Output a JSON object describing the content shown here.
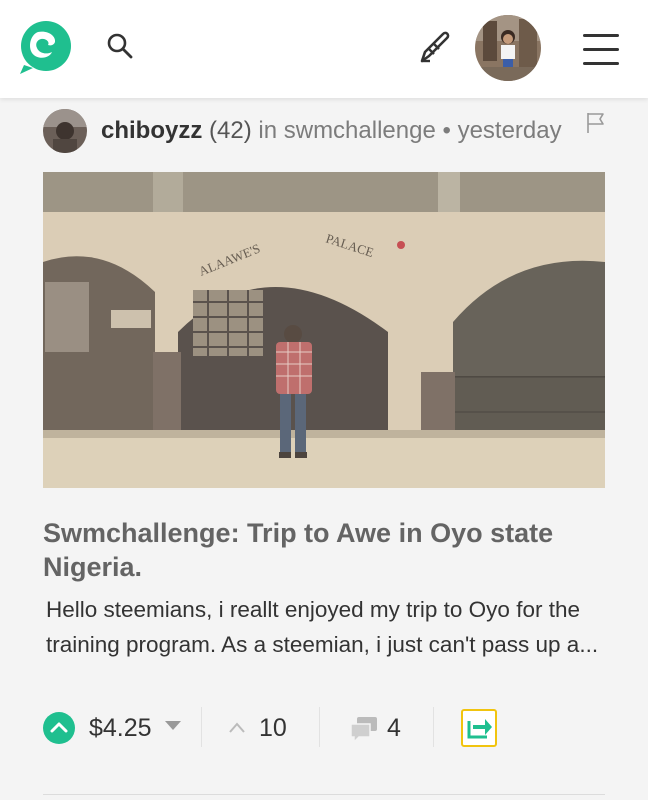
{
  "header": {
    "logo_icon": "steemit-logo-icon",
    "search_icon": "search-icon",
    "compose_icon": "pen-icon",
    "avatar": "user-avatar",
    "menu_icon": "hamburger-menu-icon",
    "brand_color": "#1fbf8f"
  },
  "post": {
    "author": "chiboyzz",
    "reputation": "(42)",
    "community_prefix": "in",
    "community": "swmchallenge",
    "separator": "•",
    "time": "yesterday",
    "flag_icon": "flag-icon",
    "sign_left": "ALAAWE'S",
    "sign_right": "PALACE",
    "title": "Swmchallenge: Trip to Awe in Oyo state Nigeria.",
    "excerpt": "Hello steemians, i reallt enjoyed my trip to Oyo for the training program. As a steemian, i just can't pass up a...",
    "payout": "$4.25",
    "votes": "10",
    "comments": "4",
    "reblog_icon": "reblog-icon"
  }
}
